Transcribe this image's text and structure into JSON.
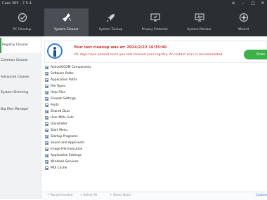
{
  "window": {
    "title": "Care 365 - 7.5.4",
    "controls": [
      "≡",
      "–",
      "□",
      "✕"
    ]
  },
  "tabs": [
    {
      "label": "PC Checkup",
      "icon": "pc-checkup-icon",
      "active": false
    },
    {
      "label": "System Cleaner",
      "icon": "broom-icon",
      "active": true
    },
    {
      "label": "System Tuneup",
      "icon": "rocket-icon",
      "active": false
    },
    {
      "label": "Privacy Protector",
      "icon": "privacy-monitor-icon",
      "active": false
    },
    {
      "label": "System Monitor",
      "icon": "system-monitor-icon",
      "active": false
    },
    {
      "label": "Wizard",
      "icon": "wizard-icon",
      "active": false
    }
  ],
  "sidebar": {
    "items": [
      {
        "label": "Registry Cleaner",
        "active": true
      },
      {
        "label": "Common Cleaner",
        "active": false
      },
      {
        "label": "Advanced Cleaner",
        "active": false
      },
      {
        "label": "System Slimming",
        "active": false
      },
      {
        "label": "Big Files Manager",
        "active": false
      }
    ]
  },
  "banner": {
    "title": "Your last cleanup was at: 2024/2/22 16:35:40",
    "note": "29, days have passed since you last cleaned your registry. An instant scan is recommended.",
    "scan_label": "Scan"
  },
  "items": [
    "ActiveX/COM Components",
    "Software Paths",
    "Application Paths",
    "File Types",
    "Help Files",
    "Firewall Settings",
    "Fonts",
    "Shared DLLs",
    "User MRU Lists",
    "Uninstaller",
    "Start Menu",
    "Startup Programs",
    "Sound and AppEvents",
    "Image File Execution",
    "Application Settings",
    "Windows Services",
    "MUI Cache"
  ],
  "footer": {
    "recommended": "+ Recommended",
    "select_all": "+ Select All",
    "select_none": "+ Select None",
    "custom": "Custom"
  },
  "colors": {
    "topbar": "#2b2e33",
    "active_tab": "#4a4e54",
    "accent_green": "#3cb04a",
    "alert_red": "#d32f2f",
    "info_blue": "#2e7bd6"
  }
}
